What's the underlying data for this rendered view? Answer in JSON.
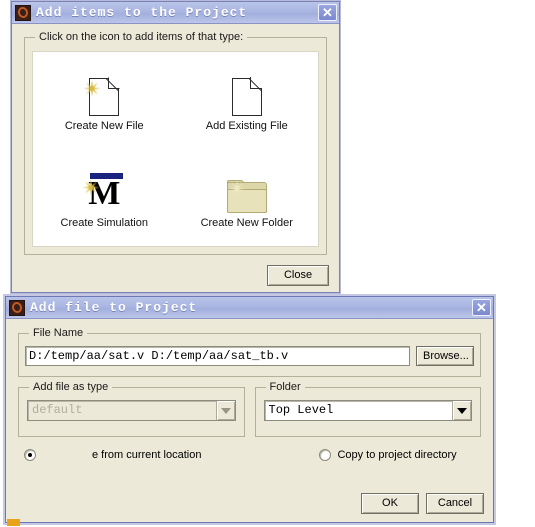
{
  "dialog_add_items": {
    "title": "Add items to the Project",
    "window_icon": "modelsim-logo-icon",
    "close_icon": "close-icon",
    "group_legend": "Click on the icon to add items of that type:",
    "icons": [
      {
        "label": "Create New File",
        "icon": "new-file-icon"
      },
      {
        "label": "Add Existing File",
        "icon": "existing-file-icon"
      },
      {
        "label": "Create Simulation",
        "icon": "create-simulation-icon"
      },
      {
        "label": "Create New Folder",
        "icon": "new-folder-icon"
      }
    ],
    "close_button": "Close"
  },
  "dialog_add_file": {
    "title": "Add file to Project",
    "window_icon": "modelsim-logo-icon",
    "close_icon": "close-icon",
    "file_name": {
      "legend": "File Name",
      "value": "D:/temp/aa/sat.v D:/temp/aa/sat_tb.v",
      "placeholder": "",
      "browse_button": "Browse..."
    },
    "file_type": {
      "legend": "Add file as type",
      "value": "default",
      "disabled": true
    },
    "folder": {
      "legend": "Folder",
      "value": "Top Level"
    },
    "radios": [
      {
        "label": "e from current location",
        "checked": true
      },
      {
        "label": "Copy to project directory",
        "checked": false
      }
    ],
    "ok_button": "OK",
    "cancel_button": "Cancel"
  },
  "colors": {
    "titlebar": "#aab6e2",
    "dialog_face": "#ece9d8",
    "panel": "#ffffff",
    "border": "#7a82b8",
    "sparkle": "#d6ba3e",
    "msim_bar": "#1a237e",
    "folder": "#ddd6a8",
    "corner_marker": "#e8a317"
  }
}
